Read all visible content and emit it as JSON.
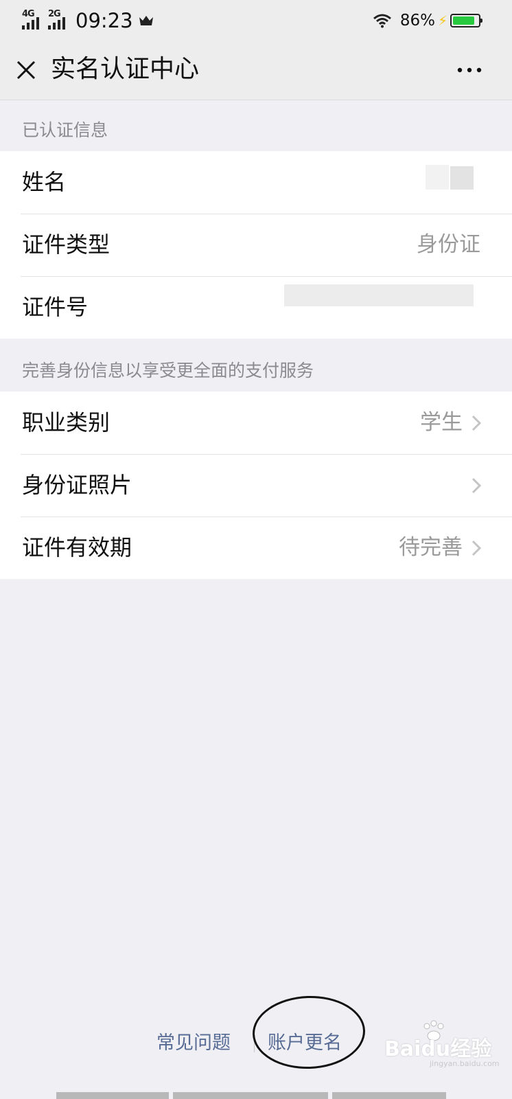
{
  "status_bar": {
    "network_1": "4G",
    "network_2": "2G",
    "time": "09:23",
    "battery_percent": "86%",
    "battery_level": 0.86
  },
  "header": {
    "title": "实名认证中心"
  },
  "verified_section": {
    "header": "已认证信息",
    "rows": [
      {
        "label": "姓名",
        "value": ""
      },
      {
        "label": "证件类型",
        "value": "身份证"
      },
      {
        "label": "证件号",
        "value": ""
      }
    ]
  },
  "improve_section": {
    "header": "完善身份信息以享受更全面的支付服务",
    "rows": [
      {
        "label": "职业类别",
        "value": "学生"
      },
      {
        "label": "身份证照片",
        "value": ""
      },
      {
        "label": "证件有效期",
        "value": "待完善"
      }
    ]
  },
  "footer": {
    "faq": "常见问题",
    "rename": "账户更名"
  },
  "watermark": {
    "brand": "Baidu经验",
    "sub": "jingyan.baidu.com"
  },
  "colors": {
    "accent_link": "#576b95",
    "background": "#efeff4",
    "battery": "#27c93f"
  }
}
